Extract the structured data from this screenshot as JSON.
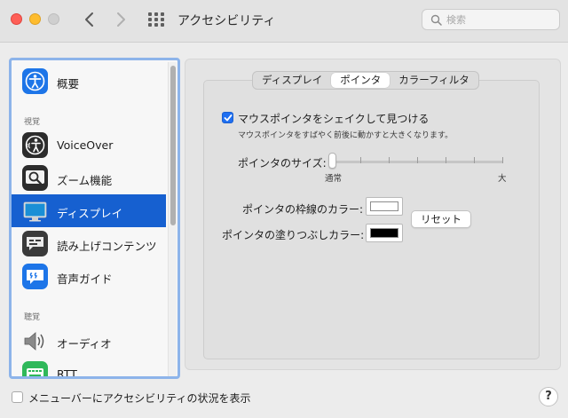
{
  "window": {
    "title": "アクセシビリティ",
    "search_placeholder": "検索"
  },
  "sidebar": {
    "items": [
      {
        "label": "概要",
        "icon": "accessibility-icon"
      },
      {
        "label": "VoiceOver",
        "icon": "voiceover-icon"
      },
      {
        "label": "ズーム機能",
        "icon": "zoom-icon"
      },
      {
        "label": "ディスプレイ",
        "icon": "display-icon",
        "selected": true
      },
      {
        "label": "読み上げコンテンツ",
        "icon": "spoken-content-icon"
      },
      {
        "label": "音声ガイド",
        "icon": "descriptions-icon"
      },
      {
        "label": "オーディオ",
        "icon": "speaker-icon"
      },
      {
        "label": "RTT",
        "icon": "rtt-icon"
      }
    ],
    "sections": [
      "視覚",
      "聴覚"
    ]
  },
  "tabs": [
    {
      "label": "ディスプレイ",
      "active": false
    },
    {
      "label": "ポインタ",
      "active": true
    },
    {
      "label": "カラーフィルタ",
      "active": false
    }
  ],
  "pointer": {
    "shake_label": "マウスポインタをシェイクして見つける",
    "shake_checked": true,
    "shake_description": "マウスポインタをすばやく前後に動かすと大きくなります。",
    "size_label": "ポインタのサイズ:",
    "size_min_label": "通常",
    "size_max_label": "大",
    "size_value": 0,
    "outline_label": "ポインタの枠線のカラー:",
    "outline_color": "#ffffff",
    "fill_label": "ポインタの塗りつぶしカラー:",
    "fill_color": "#000000",
    "reset_label": "リセット"
  },
  "footer": {
    "menubar_label": "メニューバーにアクセシビリティの状況を表示",
    "menubar_checked": false,
    "help_label": "?"
  },
  "colors": {
    "accent": "#1f6ff1",
    "selection": "#1660d0"
  }
}
